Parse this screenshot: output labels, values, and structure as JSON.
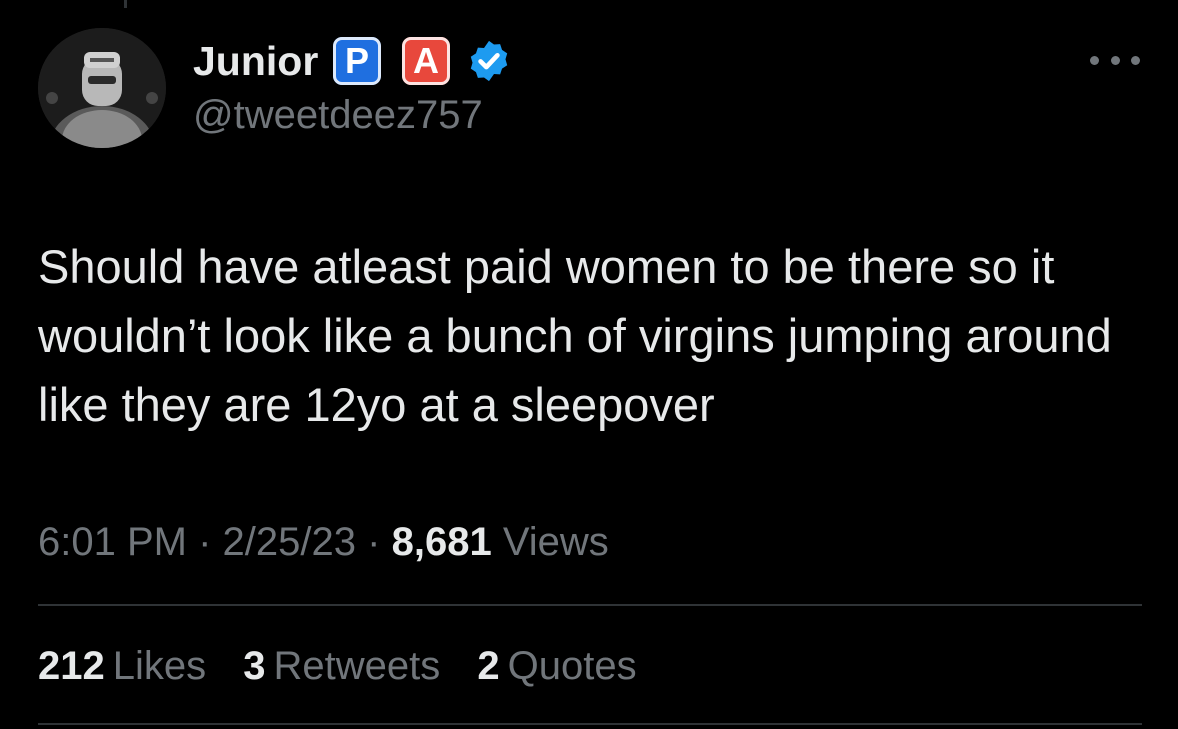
{
  "author": {
    "display_name": "Junior",
    "handle": "@tweetdeez757",
    "badge_p": "P",
    "badge_a": "A",
    "verified_icon": "verified-badge-icon",
    "avatar_icon": "avatar-masked-figure"
  },
  "tweet": {
    "text": "Should have atleast paid women to be there so it wouldn’t look like a bunch of virgins jumping around like they are 12yo at a sleepover"
  },
  "meta": {
    "time": "6:01 PM",
    "separator": "·",
    "date": "2/25/23",
    "views_count": "8,681",
    "views_label": "Views"
  },
  "stats": {
    "likes_count": "212",
    "likes_label": "Likes",
    "retweets_count": "3",
    "retweets_label": "Retweets",
    "quotes_count": "2",
    "quotes_label": "Quotes"
  },
  "colors": {
    "background": "#000000",
    "primary_text": "#e7e9ea",
    "secondary_text": "#71767b",
    "verified_blue": "#1d9bf0",
    "badge_p": "#1f6fe0",
    "badge_a": "#e8483c"
  }
}
